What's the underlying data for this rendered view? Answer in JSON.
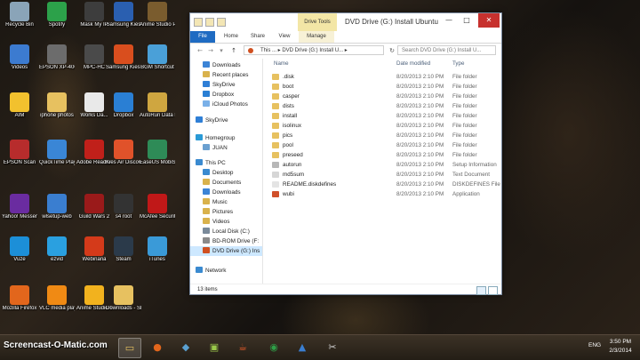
{
  "desktop": {
    "icons": [
      {
        "label": "Recycle Bin",
        "icon": "recycle-bin-icon",
        "color": "#8aa4b8"
      },
      {
        "label": "Spotify",
        "icon": "spotify-icon",
        "color": "#2ca14a"
      },
      {
        "label": "Mask My IP",
        "icon": "mask-my-ip-icon",
        "color": "#3d3d3d"
      },
      {
        "label": "Samsung Kies",
        "icon": "samsung-kies-icon",
        "color": "#2a5fb0"
      },
      {
        "label": "Anime Studio Pro",
        "icon": "anime-studio-icon",
        "color": "#7a5c2e"
      },
      {
        "label": "Videos",
        "icon": "videos-icon",
        "color": "#3c7bd0"
      },
      {
        "label": "EPSON XP-400 Series",
        "icon": "epson-printer-icon",
        "color": "#6c6c6c"
      },
      {
        "label": "MPC-HC",
        "icon": "mpc-hc-icon",
        "color": "#4a4a4a"
      },
      {
        "label": "Samsung Kies (Lite)",
        "icon": "kies-lite-icon",
        "color": "#d94e1e"
      },
      {
        "label": "BGM Shortcut",
        "icon": "bgm-icon",
        "color": "#4aa0d8"
      },
      {
        "label": "AIM",
        "icon": "aim-icon",
        "color": "#f2c12e"
      },
      {
        "label": "iphone photos",
        "icon": "folder-icon",
        "color": "#e7c160"
      },
      {
        "label": "Works Da...",
        "icon": "document-icon",
        "color": "#e9e9e9"
      },
      {
        "label": "Dropbox",
        "icon": "dropbox-icon",
        "color": "#2a7fd4"
      },
      {
        "label": "AutoRun Data Pr...",
        "icon": "autorun-icon",
        "color": "#cfa640"
      },
      {
        "label": "EPSON Scan",
        "icon": "epson-scan-icon",
        "color": "#b72c2c"
      },
      {
        "label": "QuickTime Player",
        "icon": "quicktime-icon",
        "color": "#3a86d6"
      },
      {
        "label": "Adobe Reader XI",
        "icon": "adobe-reader-icon",
        "color": "#c0201a"
      },
      {
        "label": "Kies Air Discove...",
        "icon": "kies-air-icon",
        "color": "#e0522a"
      },
      {
        "label": "EaseUS MobiSav...",
        "icon": "easeus-icon",
        "color": "#2e8b57"
      },
      {
        "label": "Yahoo! Messenger",
        "icon": "yahoo-messenger-icon",
        "color": "#6a2ca0"
      },
      {
        "label": "wlsetup-web",
        "icon": "wlsetup-icon",
        "color": "#3a7ed0"
      },
      {
        "label": "Guild Wars 2",
        "icon": "guild-wars-icon",
        "color": "#9a1a1a"
      },
      {
        "label": "s4 root",
        "icon": "s4-root-icon",
        "color": "#333333"
      },
      {
        "label": "McAfee Security Sc...",
        "icon": "mcafee-icon",
        "color": "#c01818"
      },
      {
        "label": "Vuze",
        "icon": "vuze-icon",
        "color": "#1c8fd8"
      },
      {
        "label": "ezvid",
        "icon": "ezvid-icon",
        "color": "#2aa0e0"
      },
      {
        "label": "Webinaria",
        "icon": "webinaria-icon",
        "color": "#d43a1a"
      },
      {
        "label": "Steam",
        "icon": "steam-icon",
        "color": "#2b3a4a"
      },
      {
        "label": "iTunes",
        "icon": "itunes-icon",
        "color": "#3a9ad8"
      },
      {
        "label": "Mozilla Firefox",
        "icon": "firefox-icon",
        "color": "#e2661c"
      },
      {
        "label": "VLC media player",
        "icon": "vlc-icon",
        "color": "#f08a14"
      },
      {
        "label": "Anime Studio Pro...",
        "icon": "anime-studio-pro-icon",
        "color": "#f2b21e"
      },
      {
        "label": "Downloads - Shortcut",
        "icon": "downloads-shortcut-icon",
        "color": "#e7c160"
      }
    ]
  },
  "window": {
    "title": "DVD Drive (G:) Install Ubuntu",
    "contextual_tab": "Drive Tools",
    "controls": {
      "minimize": "—",
      "maximize": "□",
      "close": "✕"
    },
    "ribbon_tabs": [
      "File",
      "Home",
      "Share",
      "View",
      "Manage"
    ],
    "nav_glyphs": {
      "back": "←",
      "forward": "→",
      "up": "↑",
      "dropdown": "▾",
      "refresh": "↻"
    },
    "address": "This ... ▸ DVD Drive (G:) Install U... ▸",
    "search_placeholder": "Search DVD Drive (G:) Install U...",
    "nav_pane": [
      {
        "label": "Downloads",
        "icon": "downloads-icon",
        "color": "#3c84d6"
      },
      {
        "label": "Recent places",
        "icon": "recent-places-icon",
        "color": "#d9b24c"
      },
      {
        "label": "SkyDrive",
        "icon": "skydrive-icon",
        "color": "#2f7fd6"
      },
      {
        "label": "Dropbox",
        "icon": "dropbox-icon",
        "color": "#2a7fd4"
      },
      {
        "label": "iCloud Photos",
        "icon": "icloud-icon",
        "color": "#7ab0e8"
      },
      {
        "label": "SkyDrive",
        "icon": "skydrive-icon",
        "color": "#2f7fd6"
      },
      {
        "label": "Homegroup",
        "icon": "homegroup-icon",
        "color": "#2a9ad6"
      },
      {
        "label": "JUAN",
        "icon": "user-icon",
        "color": "#6aa0d0"
      },
      {
        "label": "This PC",
        "icon": "this-pc-icon",
        "color": "#3a8ad0"
      },
      {
        "label": "Desktop",
        "icon": "desktop-icon",
        "color": "#3a8ad0"
      },
      {
        "label": "Documents",
        "icon": "documents-icon",
        "color": "#d9b24c"
      },
      {
        "label": "Downloads",
        "icon": "downloads-icon",
        "color": "#3c84d6"
      },
      {
        "label": "Music",
        "icon": "music-icon",
        "color": "#d9b24c"
      },
      {
        "label": "Pictures",
        "icon": "pictures-icon",
        "color": "#d9b24c"
      },
      {
        "label": "Videos",
        "icon": "videos-icon",
        "color": "#d9b24c"
      },
      {
        "label": "Local Disk (C:)",
        "icon": "local-disk-icon",
        "color": "#7a8a9a"
      },
      {
        "label": "BD-ROM Drive (F:",
        "icon": "bd-rom-icon",
        "color": "#8a8a8a"
      },
      {
        "label": "DVD Drive (G:) Ins",
        "icon": "dvd-drive-icon",
        "color": "#d05020"
      },
      {
        "label": "Network",
        "icon": "network-icon",
        "color": "#3a8ad0"
      }
    ],
    "columns": [
      "Name",
      "Date modified",
      "Type"
    ],
    "files": [
      {
        "name": ".disk",
        "date": "8/20/2013 2:10 PM",
        "type": "File folder",
        "icon": "folder-icon",
        "color": "#e7c160"
      },
      {
        "name": "boot",
        "date": "8/20/2013 2:10 PM",
        "type": "File folder",
        "icon": "folder-icon",
        "color": "#e7c160"
      },
      {
        "name": "casper",
        "date": "8/20/2013 2:10 PM",
        "type": "File folder",
        "icon": "folder-icon",
        "color": "#e7c160"
      },
      {
        "name": "dists",
        "date": "8/20/2013 2:10 PM",
        "type": "File folder",
        "icon": "folder-icon",
        "color": "#e7c160"
      },
      {
        "name": "install",
        "date": "8/20/2013 2:10 PM",
        "type": "File folder",
        "icon": "folder-icon",
        "color": "#e7c160"
      },
      {
        "name": "isolinux",
        "date": "8/20/2013 2:10 PM",
        "type": "File folder",
        "icon": "folder-icon",
        "color": "#e7c160"
      },
      {
        "name": "pics",
        "date": "8/20/2013 2:10 PM",
        "type": "File folder",
        "icon": "folder-icon",
        "color": "#e7c160"
      },
      {
        "name": "pool",
        "date": "8/20/2013 2:10 PM",
        "type": "File folder",
        "icon": "folder-icon",
        "color": "#e7c160"
      },
      {
        "name": "preseed",
        "date": "8/20/2013 2:10 PM",
        "type": "File folder",
        "icon": "folder-icon",
        "color": "#e7c160"
      },
      {
        "name": "autorun",
        "date": "8/20/2013 2:10 PM",
        "type": "Setup Information",
        "icon": "setup-file-icon",
        "color": "#b7b7b7"
      },
      {
        "name": "md5sum",
        "date": "8/20/2013 2:10 PM",
        "type": "Text Document",
        "icon": "text-file-icon",
        "color": "#d6d6d6"
      },
      {
        "name": "README.diskdefines",
        "date": "8/20/2013 2:10 PM",
        "type": "DISKDEFINES File",
        "icon": "file-icon",
        "color": "#e4e4e4"
      },
      {
        "name": "wubi",
        "date": "8/20/2013 2:10 PM",
        "type": "Application",
        "icon": "wubi-icon",
        "color": "#d0502a"
      }
    ],
    "status": "13 items"
  },
  "taskbar": {
    "watermark": "Screencast-O-Matic.com",
    "buttons": [
      {
        "name": "file-explorer-taskbar-button",
        "glyph": "▭",
        "color": "#e7c160",
        "active": true
      },
      {
        "name": "firefox-taskbar-button",
        "glyph": "●",
        "color": "#e2661c",
        "active": false
      },
      {
        "name": "app-taskbar-button",
        "glyph": "◆",
        "color": "#5aa0d0",
        "active": false
      },
      {
        "name": "photos-taskbar-button",
        "glyph": "▣",
        "color": "#9ac84a",
        "active": false
      },
      {
        "name": "java-taskbar-button",
        "glyph": "☕",
        "color": "#e05a2a",
        "active": false
      },
      {
        "name": "chrome-taskbar-button",
        "glyph": "◉",
        "color": "#2e9e47",
        "active": false
      },
      {
        "name": "pinned-app-taskbar-button",
        "glyph": "▲",
        "color": "#3a7ed0",
        "active": false
      },
      {
        "name": "snipping-taskbar-button",
        "glyph": "✂",
        "color": "#cfcfcf",
        "active": false
      }
    ],
    "tray_language": "ENG",
    "time": "3:50 PM",
    "date": "2/3/2014"
  }
}
